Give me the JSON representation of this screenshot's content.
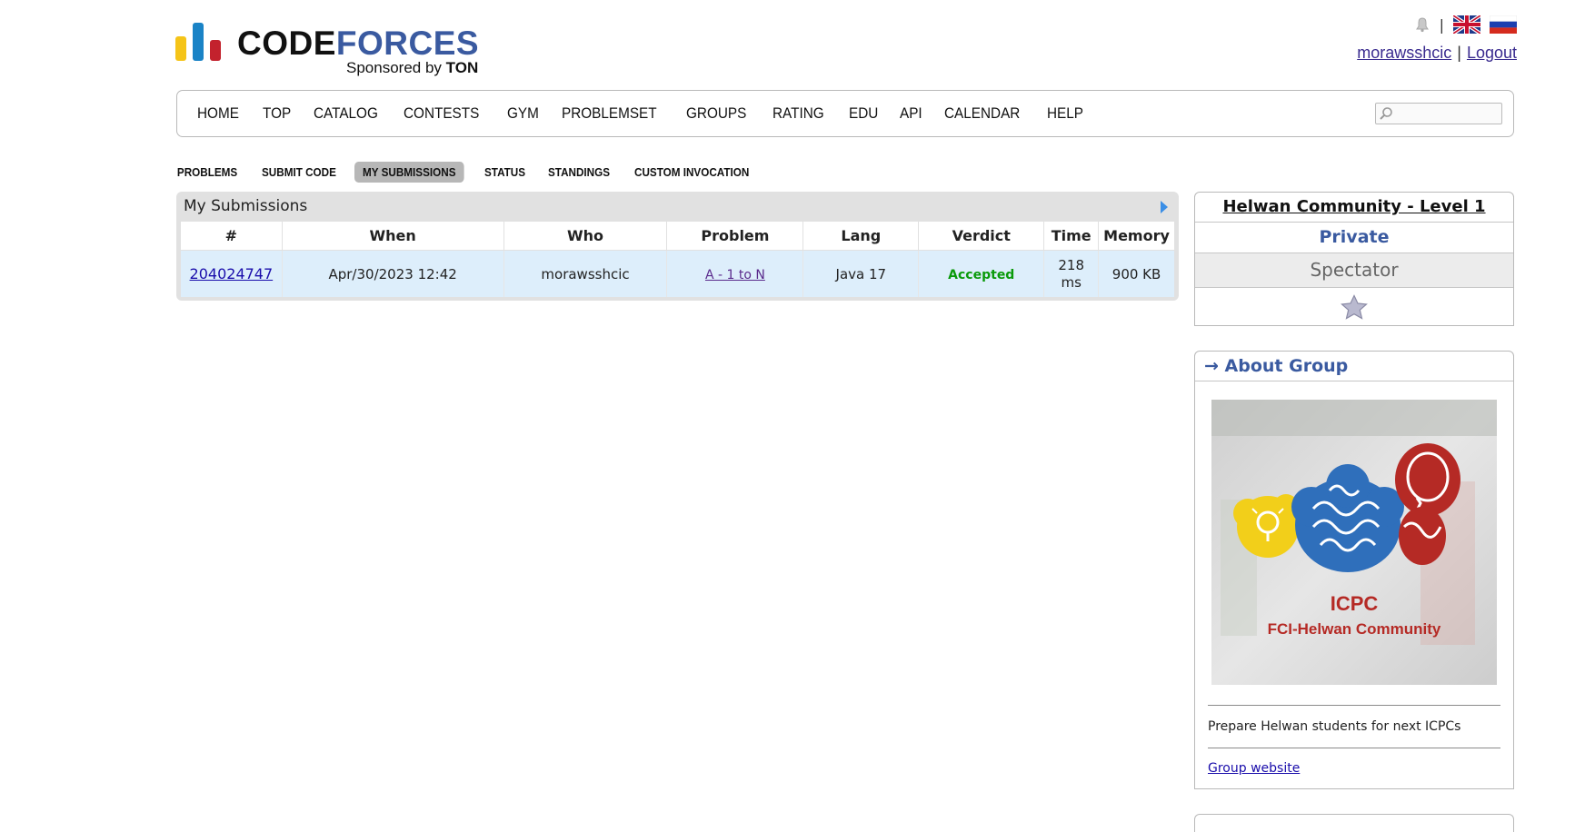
{
  "header": {
    "logo_text_dark": "CODE",
    "logo_text_blue": "FORCES",
    "sponsor_prefix": "Sponsored by",
    "sponsor_name": "TON",
    "separator": "|",
    "username": "morawsshcic",
    "user_separator": "|",
    "logout": "Logout"
  },
  "main_menu": {
    "items": [
      "HOME",
      "TOP",
      "CATALOG",
      "CONTESTS",
      "GYM",
      "PROBLEMSET",
      "GROUPS",
      "RATING",
      "EDU",
      "API",
      "CALENDAR",
      "HELP"
    ],
    "search_value": ""
  },
  "sub_menu": {
    "items": [
      "PROBLEMS",
      "SUBMIT CODE",
      "MY SUBMISSIONS",
      "STATUS",
      "STANDINGS",
      "CUSTOM INVOCATION"
    ],
    "selected": "MY SUBMISSIONS"
  },
  "submissions": {
    "title": "My Submissions",
    "columns": [
      "#",
      "When",
      "Who",
      "Problem",
      "Lang",
      "Verdict",
      "Time",
      "Memory"
    ],
    "rows": [
      {
        "id": "204024747",
        "when": "Apr/30/2023 12:42",
        "who": "morawsshcic",
        "problem": "A - 1 to N",
        "lang": "Java 17",
        "verdict": "Accepted",
        "time_value": "218",
        "time_unit": "ms",
        "memory": "900 KB"
      }
    ]
  },
  "sidebar": {
    "group_title": "Helwan Community - Level 1",
    "privacy": "Private",
    "role": "Spectator",
    "star_icon": "star-icon",
    "about_title": "→ About Group",
    "logo_line1": "ICPC",
    "logo_line2": "FCI-Helwan Community",
    "description": "Prepare Helwan students for next ICPCs",
    "website_link": "Group website"
  },
  "colors": {
    "accent_blue": "#3a5aa0",
    "verdict_green": "#0a9a0a",
    "row_highlight": "#ddeefb",
    "selected_tab": "#b7b7b7"
  }
}
